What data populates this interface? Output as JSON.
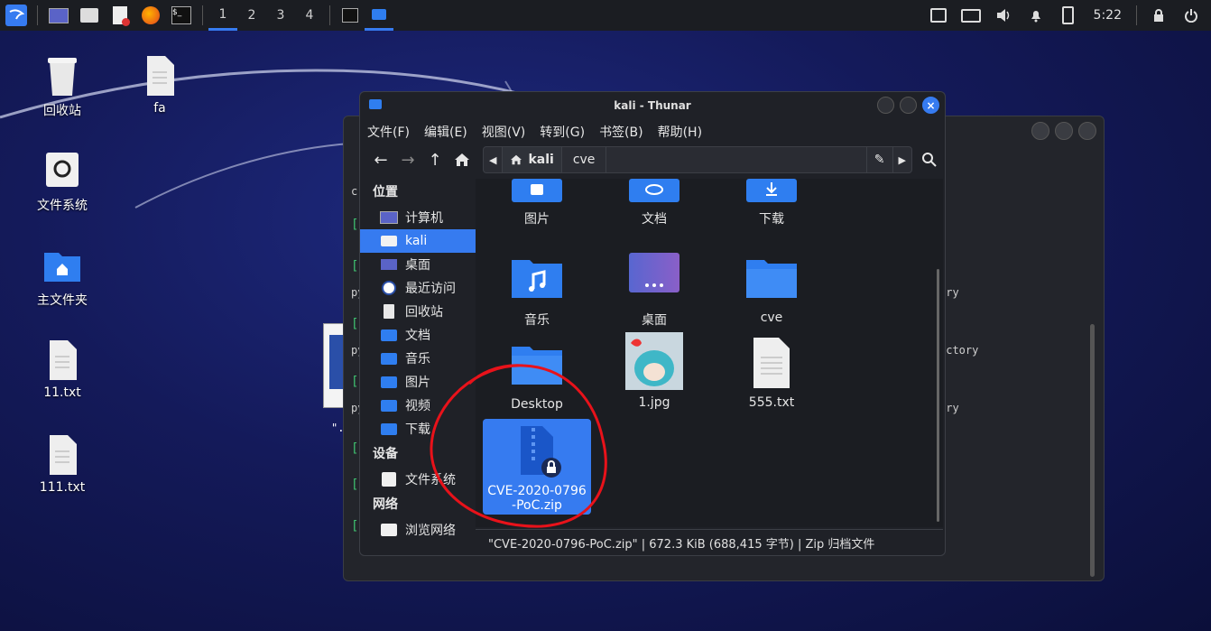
{
  "panel": {
    "workspaces": [
      "1",
      "2",
      "3",
      "4"
    ],
    "active_workspace": "1",
    "clock": "5:22"
  },
  "desktop": {
    "icons": [
      {
        "label": "回收站",
        "icon": "trash-icon"
      },
      {
        "label": "fa",
        "icon": "file-icon"
      },
      {
        "label": "文件系统",
        "icon": "drive-icon"
      },
      {
        "label": "主文件夹",
        "icon": "home-folder-icon"
      },
      {
        "label": "11.txt",
        "icon": "text-file-icon"
      },
      {
        "label": "111.txt",
        "icon": "text-file-icon"
      }
    ]
  },
  "bgwindow": {
    "lines": [
      "c",
      "py",
      "py",
      "py",
      "\"."
    ],
    "right_lines": [
      "ory",
      "ectory",
      "ory"
    ]
  },
  "thunar": {
    "title": "kali - Thunar",
    "menu": [
      "文件(F)",
      "编辑(E)",
      "视图(V)",
      "转到(G)",
      "书签(B)",
      "帮助(H)"
    ],
    "path": [
      "kali",
      "cve"
    ],
    "sidebar": {
      "places_header": "位置",
      "places": [
        {
          "label": "计算机",
          "icon": "computer-icon"
        },
        {
          "label": "kali",
          "icon": "home-icon",
          "selected": true
        },
        {
          "label": "桌面",
          "icon": "desktop-icon"
        },
        {
          "label": "最近访问",
          "icon": "recent-icon"
        },
        {
          "label": "回收站",
          "icon": "trash-icon"
        },
        {
          "label": "文档",
          "icon": "documents-folder-icon"
        },
        {
          "label": "音乐",
          "icon": "music-folder-icon"
        },
        {
          "label": "图片",
          "icon": "pictures-folder-icon"
        },
        {
          "label": "视频",
          "icon": "videos-folder-icon"
        },
        {
          "label": "下载",
          "icon": "downloads-folder-icon"
        }
      ],
      "devices_header": "设备",
      "devices": [
        {
          "label": "文件系统",
          "icon": "drive-icon"
        }
      ],
      "network_header": "网络",
      "network": [
        {
          "label": "浏览网络",
          "icon": "network-icon"
        }
      ]
    },
    "files": [
      {
        "label": "图片",
        "kind": "pictures-folder"
      },
      {
        "label": "文档",
        "kind": "documents-folder"
      },
      {
        "label": "下载",
        "kind": "downloads-folder"
      },
      {
        "label": "音乐",
        "kind": "music-folder"
      },
      {
        "label": "桌面",
        "kind": "desktop-folder"
      },
      {
        "label": "cve",
        "kind": "folder"
      },
      {
        "label": "Desktop",
        "kind": "folder"
      },
      {
        "label": "1.jpg",
        "kind": "image"
      },
      {
        "label": "555.txt",
        "kind": "text"
      },
      {
        "label": "CVE-2020-0796-PoC.zip",
        "kind": "zip",
        "selected": true
      }
    ],
    "status": "\"CVE-2020-0796-PoC.zip\" | 672.3 KiB (688,415 字节) | Zip 归档文件"
  },
  "colors": {
    "accent": "#367bf0",
    "folder": "#2f7ef0",
    "annotation": "#e8121a"
  }
}
